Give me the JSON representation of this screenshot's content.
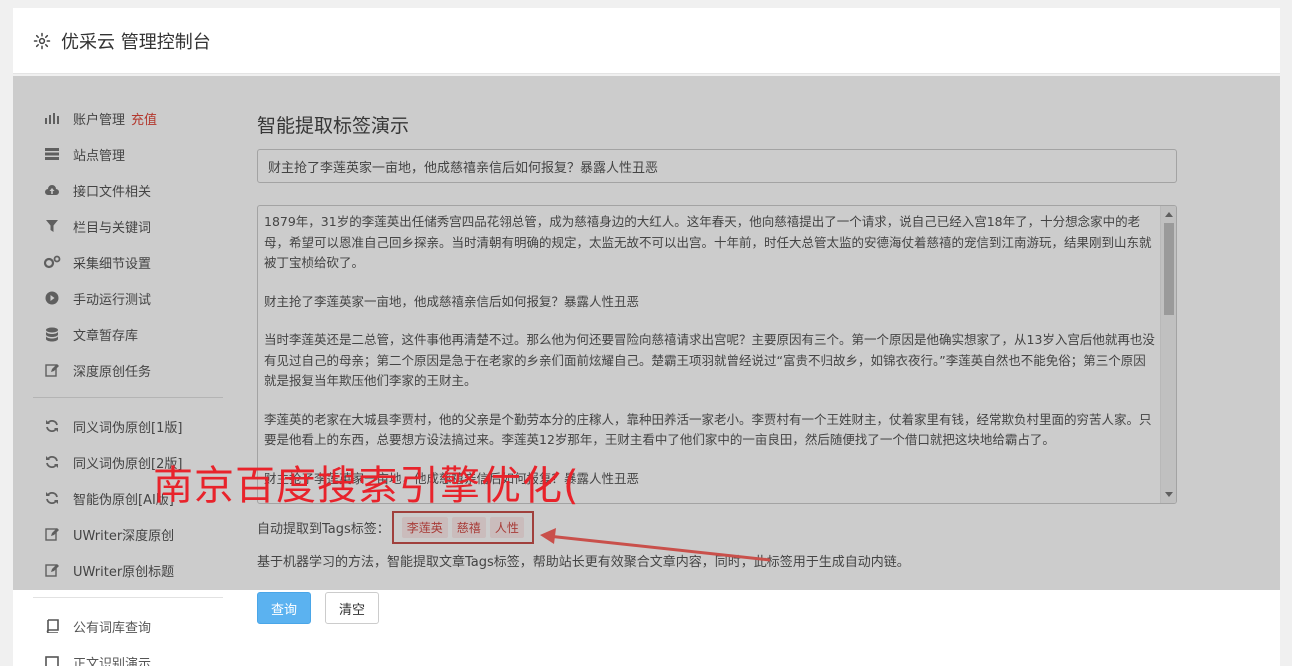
{
  "header": {
    "title": "优采云 管理控制台",
    "icon": "gear-icon"
  },
  "sidebar": {
    "group1": [
      {
        "label": "账户管理",
        "badge": "充值",
        "icon": "bar-chart-icon"
      },
      {
        "label": "站点管理",
        "icon": "server-icon"
      },
      {
        "label": "接口文件相关",
        "icon": "cloud-upload-icon"
      },
      {
        "label": "栏目与关键词",
        "icon": "filter-icon"
      },
      {
        "label": "采集细节设置",
        "icon": "gears-icon"
      },
      {
        "label": "手动运行测试",
        "icon": "play-circle-icon"
      },
      {
        "label": "文章暂存库",
        "icon": "database-icon"
      },
      {
        "label": "深度原创任务",
        "icon": "edit-icon"
      }
    ],
    "group2": [
      {
        "label": "同义词伪原创[1版]",
        "icon": "refresh-icon"
      },
      {
        "label": "同义词伪原创[2版]",
        "icon": "refresh-icon"
      },
      {
        "label": "智能伪原创[AI版]",
        "icon": "refresh-icon"
      },
      {
        "label": "UWriter深度原创",
        "icon": "edit-icon"
      },
      {
        "label": "UWriter原创标题",
        "icon": "edit-icon"
      }
    ],
    "group3": [
      {
        "label": "公有词库查询",
        "icon": "book-icon"
      },
      {
        "label": "正文识别演示",
        "icon": "window-icon"
      }
    ]
  },
  "main": {
    "page_title": "智能提取标签演示",
    "title_value": "财主抢了李莲英家一亩地，他成慈禧亲信后如何报复？暴露人性丑恶",
    "content_paragraphs": [
      "1879年，31岁的李莲英出任储秀宫四品花翎总管，成为慈禧身边的大红人。这年春天，他向慈禧提出了一个请求，说自己已经入宫18年了，十分想念家中的老母，希望可以恩准自己回乡探亲。当时清朝有明确的规定，太监无故不可以出宫。十年前，时任大总管太监的安德海仗着慈禧的宠信到江南游玩，结果刚到山东就被丁宝桢给砍了。",
      "财主抢了李莲英家一亩地，他成慈禧亲信后如何报复？暴露人性丑恶",
      "当时李莲英还是二总管，这件事他再清楚不过。那么他为何还要冒险向慈禧请求出宫呢？主要原因有三个。第一个原因是他确实想家了，从13岁入宫后他就再也没有见过自己的母亲；第二个原因是急于在老家的乡亲们面前炫耀自己。楚霸王项羽就曾经说过“富贵不归故乡，如锦衣夜行。”李莲英自然也不能免俗；第三个原因就是报复当年欺压他们李家的王财主。",
      "李莲英的老家在大城县李贾村，他的父亲是个勤劳本分的庄稼人，靠种田养活一家老小。李贾村有一个王姓财主，仗着家里有钱，经常欺负村里面的穷苦人家。只要是他看上的东西，总要想方设法搞过来。李莲英12岁那年，王财主看中了他们家中的一亩良田，然后随便找了一个借口就把这块地给霸占了。",
      "财主抢了李莲英家一亩地，他成慈禧亲信后如何报复？暴露人性丑恶"
    ],
    "tags_label": "自动提取到Tags标签：",
    "tags": [
      "李莲英",
      "慈禧",
      "人性"
    ],
    "description": "基于机器学习的方法，智能提取文章Tags标签，帮助站长更有效聚合文章内容，同时，此标签用于生成自动内链。",
    "query_button": "查询",
    "clear_button": "清空"
  },
  "watermark": "南京百度搜索引擎优化(",
  "colors": {
    "accent": "#5bb2f0",
    "badge": "#e0473a",
    "tag_border": "#c9504b",
    "watermark": "#e8232b"
  }
}
